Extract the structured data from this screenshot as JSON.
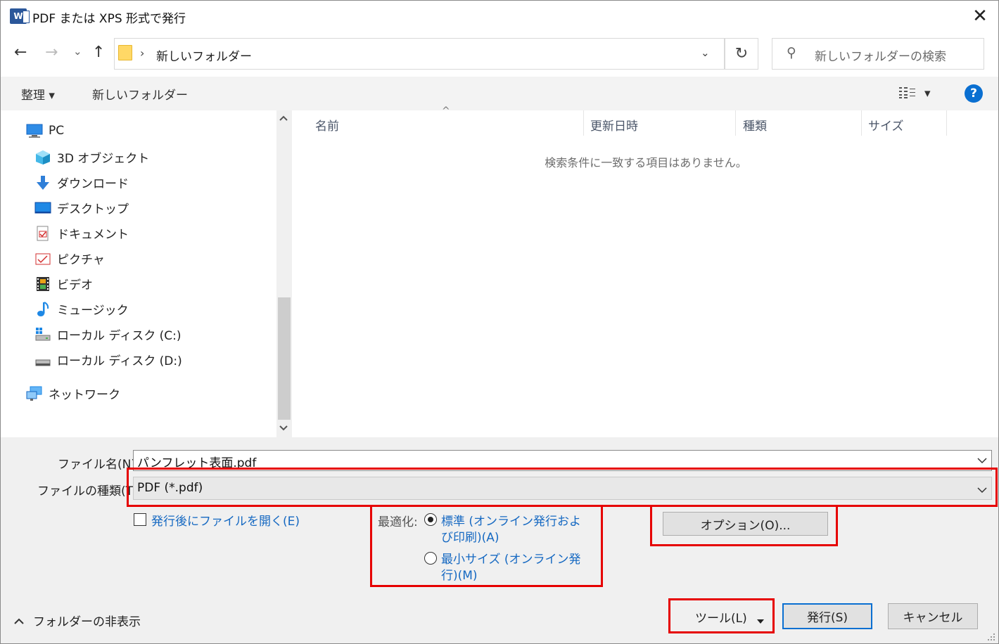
{
  "window": {
    "title": "PDF または XPS 形式で発行",
    "app_icon": "W",
    "close_label": "✕"
  },
  "nav_buttons": {
    "back": "←",
    "forward": "→",
    "recent": "⌄",
    "up": "↑"
  },
  "address": {
    "separator": "›",
    "path": "新しいフォルダー",
    "dropdown": "⌄",
    "refresh": "↻"
  },
  "search": {
    "placeholder": "新しいフォルダーの検索",
    "icon": "⚲"
  },
  "toolbar": {
    "organize": "整理 ▾",
    "new_folder": "新しいフォルダー",
    "view": "▾",
    "help": "?"
  },
  "sidebar": {
    "pc": "PC",
    "items": [
      "3D オブジェクト",
      "ダウンロード",
      "デスクトップ",
      "ドキュメント",
      "ピクチャ",
      "ビデオ",
      "ミュージック",
      "ローカル ディスク (C:)",
      "ローカル ディスク (D:)"
    ],
    "network": "ネットワーク"
  },
  "list": {
    "columns": [
      "名前",
      "更新日時",
      "種類",
      "サイズ"
    ],
    "sort_indicator": "^",
    "empty_message": "検索条件に一致する項目はありません。"
  },
  "form": {
    "filename_label": "ファイル名(N):",
    "filename_value": "パンフレット表面.pdf",
    "filetype_label": "ファイルの種類(T):",
    "filetype_value": "PDF (*.pdf)",
    "open_after_label": "発行後にファイルを開く(E)",
    "optimize_label": "最適化:",
    "opt_standard_1": "標準 (オンライン発行およ",
    "opt_standard_2": "び印刷)(A)",
    "opt_min_1": "最小サイズ (オンライン発",
    "opt_min_2": "行)(M)",
    "options_button": "オプション(O)..."
  },
  "footer": {
    "hide_folders": "フォルダーの非表示",
    "tools": "ツール(L)",
    "publish": "発行(S)",
    "cancel": "キャンセル"
  }
}
